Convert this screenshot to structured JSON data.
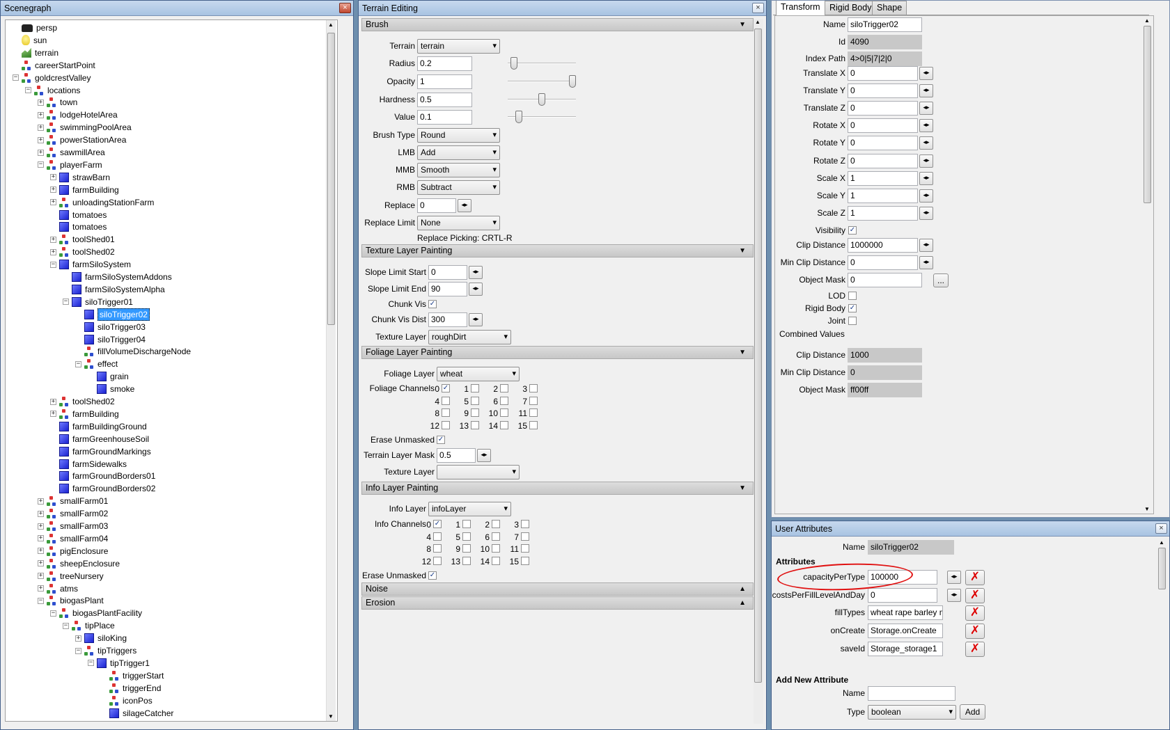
{
  "scenegraph": {
    "title": "Scenegraph",
    "close": "×",
    "items": [
      {
        "label": "persp",
        "icon": "camera",
        "depth": 0,
        "exp": ""
      },
      {
        "label": "sun",
        "icon": "light",
        "depth": 0,
        "exp": ""
      },
      {
        "label": "terrain",
        "icon": "terrain",
        "depth": 0,
        "exp": ""
      },
      {
        "label": "careerStartPoint",
        "icon": "tg",
        "depth": 0,
        "exp": ""
      },
      {
        "label": "goldcrestValley",
        "icon": "tg",
        "depth": 0,
        "exp": "-"
      },
      {
        "label": "locations",
        "icon": "tg",
        "depth": 1,
        "exp": "-"
      },
      {
        "label": "town",
        "icon": "tg",
        "depth": 2,
        "exp": "+"
      },
      {
        "label": "lodgeHotelArea",
        "icon": "tg",
        "depth": 2,
        "exp": "+"
      },
      {
        "label": "swimmingPoolArea",
        "icon": "tg",
        "depth": 2,
        "exp": "+"
      },
      {
        "label": "powerStationArea",
        "icon": "tg",
        "depth": 2,
        "exp": "+"
      },
      {
        "label": "sawmillArea",
        "icon": "tg",
        "depth": 2,
        "exp": "+"
      },
      {
        "label": "playerFarm",
        "icon": "tg",
        "depth": 2,
        "exp": "-"
      },
      {
        "label": "strawBarn",
        "icon": "mesh",
        "depth": 3,
        "exp": "+"
      },
      {
        "label": "farmBuilding",
        "icon": "mesh",
        "depth": 3,
        "exp": "+"
      },
      {
        "label": "unloadingStationFarm",
        "icon": "tg",
        "depth": 3,
        "exp": "+"
      },
      {
        "label": "tomatoes",
        "icon": "mesh",
        "depth": 3,
        "exp": ""
      },
      {
        "label": "tomatoes",
        "icon": "mesh",
        "depth": 3,
        "exp": ""
      },
      {
        "label": "toolShed01",
        "icon": "tg",
        "depth": 3,
        "exp": "+"
      },
      {
        "label": "toolShed02",
        "icon": "tg",
        "depth": 3,
        "exp": "+"
      },
      {
        "label": "farmSiloSystem",
        "icon": "mesh",
        "depth": 3,
        "exp": "-"
      },
      {
        "label": "farmSiloSystemAddons",
        "icon": "mesh",
        "depth": 4,
        "exp": ""
      },
      {
        "label": "farmSiloSystemAlpha",
        "icon": "mesh",
        "depth": 4,
        "exp": ""
      },
      {
        "label": "siloTrigger01",
        "icon": "mesh",
        "depth": 4,
        "exp": "-"
      },
      {
        "label": "siloTrigger02",
        "icon": "mesh",
        "depth": 5,
        "exp": "",
        "selected": true
      },
      {
        "label": "siloTrigger03",
        "icon": "mesh",
        "depth": 5,
        "exp": ""
      },
      {
        "label": "siloTrigger04",
        "icon": "mesh",
        "depth": 5,
        "exp": ""
      },
      {
        "label": "fillVolumeDischargeNode",
        "icon": "tg",
        "depth": 5,
        "exp": ""
      },
      {
        "label": "effect",
        "icon": "tg",
        "depth": 5,
        "exp": "-"
      },
      {
        "label": "grain",
        "icon": "mesh",
        "depth": 6,
        "exp": ""
      },
      {
        "label": "smoke",
        "icon": "mesh",
        "depth": 6,
        "exp": ""
      },
      {
        "label": "toolShed02",
        "icon": "tg",
        "depth": 3,
        "exp": "+"
      },
      {
        "label": "farmBuilding",
        "icon": "tg",
        "depth": 3,
        "exp": "+"
      },
      {
        "label": "farmBuildingGround",
        "icon": "mesh",
        "depth": 3,
        "exp": ""
      },
      {
        "label": "farmGreenhouseSoil",
        "icon": "mesh",
        "depth": 3,
        "exp": ""
      },
      {
        "label": "farmGroundMarkings",
        "icon": "mesh",
        "depth": 3,
        "exp": ""
      },
      {
        "label": "farmSidewalks",
        "icon": "mesh",
        "depth": 3,
        "exp": ""
      },
      {
        "label": "farmGroundBorders01",
        "icon": "mesh",
        "depth": 3,
        "exp": ""
      },
      {
        "label": "farmGroundBorders02",
        "icon": "mesh",
        "depth": 3,
        "exp": ""
      },
      {
        "label": "smallFarm01",
        "icon": "tg",
        "depth": 2,
        "exp": "+"
      },
      {
        "label": "smallFarm02",
        "icon": "tg",
        "depth": 2,
        "exp": "+"
      },
      {
        "label": "smallFarm03",
        "icon": "tg",
        "depth": 2,
        "exp": "+"
      },
      {
        "label": "smallFarm04",
        "icon": "tg",
        "depth": 2,
        "exp": "+"
      },
      {
        "label": "pigEnclosure",
        "icon": "tg",
        "depth": 2,
        "exp": "+"
      },
      {
        "label": "sheepEnclosure",
        "icon": "tg",
        "depth": 2,
        "exp": "+"
      },
      {
        "label": "treeNursery",
        "icon": "tg",
        "depth": 2,
        "exp": "+"
      },
      {
        "label": "atms",
        "icon": "tg",
        "depth": 2,
        "exp": "+"
      },
      {
        "label": "biogasPlant",
        "icon": "tg",
        "depth": 2,
        "exp": "-"
      },
      {
        "label": "biogasPlantFacility",
        "icon": "tg",
        "depth": 3,
        "exp": "-"
      },
      {
        "label": "tipPlace",
        "icon": "tg",
        "depth": 4,
        "exp": "-"
      },
      {
        "label": "siloKing",
        "icon": "mesh",
        "depth": 5,
        "exp": "+"
      },
      {
        "label": "tipTriggers",
        "icon": "tg",
        "depth": 5,
        "exp": "-"
      },
      {
        "label": "tipTrigger1",
        "icon": "mesh",
        "depth": 6,
        "exp": "-"
      },
      {
        "label": "triggerStart",
        "icon": "tg",
        "depth": 7,
        "exp": ""
      },
      {
        "label": "triggerEnd",
        "icon": "tg",
        "depth": 7,
        "exp": ""
      },
      {
        "label": "iconPos",
        "icon": "tg",
        "depth": 7,
        "exp": ""
      },
      {
        "label": "silageCatcher",
        "icon": "mesh",
        "depth": 7,
        "exp": ""
      }
    ]
  },
  "terrain": {
    "title": "Terrain Editing",
    "close": "×",
    "sections": {
      "brush": "Brush",
      "texture": "Texture Layer Painting",
      "foliage": "Foliage Layer Painting",
      "info": "Info Layer Painting",
      "noise": "Noise",
      "erosion": "Erosion"
    },
    "arrow_down": "▼",
    "arrow_up": "▲",
    "brush": {
      "terrain_label": "Terrain",
      "terrain_value": "terrain",
      "radius_label": "Radius",
      "radius_value": "0.2",
      "radius_level": 0.05,
      "opacity_label": "Opacity",
      "opacity_value": "1",
      "opacity_level": 1.0,
      "hardness_label": "Hardness",
      "hardness_value": "0.5",
      "hardness_level": 0.5,
      "value_label": "Value",
      "value_value": "0.1",
      "value_level": 0.12,
      "brushtype_label": "Brush Type",
      "brushtype_value": "Round",
      "lmb_label": "LMB",
      "lmb_value": "Add",
      "mmb_label": "MMB",
      "mmb_value": "Smooth",
      "rmb_label": "RMB",
      "rmb_value": "Subtract",
      "replace_label": "Replace",
      "replace_value": "0",
      "replacelimit_label": "Replace Limit",
      "replacelimit_value": "None",
      "picking": "Replace Picking: CRTL-R"
    },
    "texture": {
      "slopestart_label": "Slope Limit Start",
      "slopestart_value": "0",
      "slopeend_label": "Slope Limit End",
      "slopeend_value": "90",
      "chunkvis_label": "Chunk Vis",
      "chunkdist_label": "Chunk Vis Dist",
      "chunkdist_value": "300",
      "layer_label": "Texture Layer",
      "layer_value": "roughDirt"
    },
    "foliage": {
      "layer_label": "Foliage Layer",
      "layer_value": "wheat",
      "channels_label": "Foliage Channels",
      "channels": [
        "0",
        "1",
        "2",
        "3",
        "4",
        "5",
        "6",
        "7",
        "8",
        "9",
        "10",
        "11",
        "12",
        "13",
        "14",
        "15"
      ],
      "erase_label": "Erase Unmasked",
      "mask_label": "Terrain Layer Mask",
      "mask_value": "0.5",
      "texlayer_label": "Texture Layer",
      "texlayer_value": ""
    },
    "info": {
      "layer_label": "Info Layer",
      "layer_value": "infoLayer",
      "channels_label": "Info Channels",
      "channels": [
        "0",
        "1",
        "2",
        "3",
        "4",
        "5",
        "6",
        "7",
        "8",
        "9",
        "10",
        "11",
        "12",
        "13",
        "14",
        "15"
      ],
      "erase_label": "Erase Unmasked"
    },
    "spin": "◂▸"
  },
  "attributes": {
    "tabs": [
      "Transform",
      "Rigid Body",
      "Shape"
    ],
    "fields": [
      {
        "label": "Name",
        "value": "siloTrigger02",
        "ro": false,
        "spin": false
      },
      {
        "label": "Id",
        "value": "4090",
        "ro": true,
        "spin": false
      },
      {
        "label": "Index Path",
        "value": "4>0|5|7|2|0",
        "ro": true,
        "spin": false
      },
      {
        "label": "Translate X",
        "value": "0",
        "ro": false,
        "spin": true
      },
      {
        "label": "Translate Y",
        "value": "0",
        "ro": false,
        "spin": true
      },
      {
        "label": "Translate Z",
        "value": "0",
        "ro": false,
        "spin": true
      },
      {
        "label": "Rotate X",
        "value": "0",
        "ro": false,
        "spin": true
      },
      {
        "label": "Rotate Y",
        "value": "0",
        "ro": false,
        "spin": true
      },
      {
        "label": "Rotate Z",
        "value": "0",
        "ro": false,
        "spin": true
      },
      {
        "label": "Scale X",
        "value": "1",
        "ro": false,
        "spin": true
      },
      {
        "label": "Scale Y",
        "value": "1",
        "ro": false,
        "spin": true
      },
      {
        "label": "Scale Z",
        "value": "1",
        "ro": false,
        "spin": true
      }
    ],
    "visibility_label": "Visibility",
    "clipdist_label": "Clip Distance",
    "clipdist_value": "1000000",
    "minclip_label": "Min Clip Distance",
    "minclip_value": "0",
    "objmask_label": "Object Mask",
    "objmask_value": "0",
    "objmask_btn": "...",
    "lod_label": "LOD",
    "rigid_label": "Rigid Body",
    "joint_label": "Joint",
    "combined_label": "Combined Values",
    "c_clip_label": "Clip Distance",
    "c_clip_value": "1000",
    "c_minclip_label": "Min Clip Distance",
    "c_minclip_value": "0",
    "c_mask_label": "Object Mask",
    "c_mask_value": "ff00ff"
  },
  "user": {
    "title": "User Attributes",
    "close": "×",
    "name_label": "Name",
    "name_value": "siloTrigger02",
    "attrs_header": "Attributes",
    "attrs": [
      {
        "label": "capacityPerType",
        "value": "100000",
        "spin": true
      },
      {
        "label": "costsPerFillLevelAndDay",
        "value": "0",
        "spin": true
      },
      {
        "label": "fillTypes",
        "value": "wheat rape barley m",
        "spin": false
      },
      {
        "label": "onCreate",
        "value": "Storage.onCreate",
        "spin": false
      },
      {
        "label": "saveId",
        "value": "Storage_storage1",
        "spin": false
      }
    ],
    "del": "✗",
    "add_header": "Add New Attribute",
    "new_name_label": "Name",
    "new_name_value": "",
    "type_label": "Type",
    "type_value": "boolean",
    "add_btn": "Add"
  },
  "colors": {
    "selection": "#3399ff",
    "annotation": "#e01010"
  }
}
